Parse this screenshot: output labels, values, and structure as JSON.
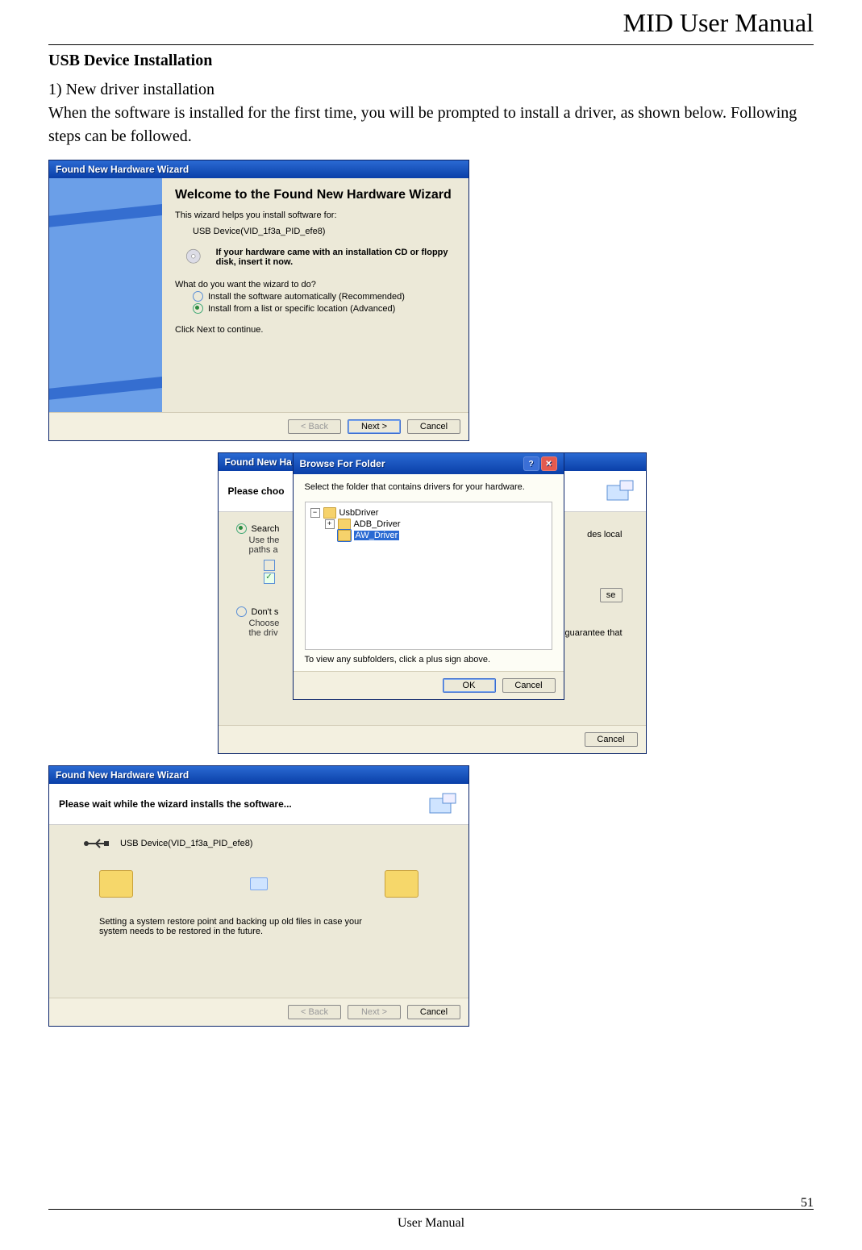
{
  "page": {
    "header_title": "MID User Manual",
    "section_heading": "USB Device Installation",
    "subhead": "1) New driver installation",
    "intro": "When the software is installed for the first time, you will be prompted to install a driver, as shown below. Following steps can be followed.",
    "footer_label": "User Manual",
    "page_number": "51"
  },
  "wizard1": {
    "title": "Found New Hardware Wizard",
    "heading": "Welcome to the Found New Hardware Wizard",
    "line1": "This wizard helps you install software for:",
    "device": "USB Device(VID_1f3a_PID_efe8)",
    "hint": "If your hardware came with an installation CD or floppy disk, insert it now.",
    "question": "What do you want the wizard to do?",
    "opt1": "Install the software automatically (Recommended)",
    "opt2": "Install from a list or specific location (Advanced)",
    "continue": "Click Next to continue.",
    "btn_back": "< Back",
    "btn_next": "Next >",
    "btn_cancel": "Cancel"
  },
  "wizard2_back": {
    "title": "Found New Ha",
    "head": "Please choo",
    "opt_search": "Search",
    "search_sub": "Use the\npaths a",
    "opt_dont": "Don't s",
    "dont_sub": "Choose\nthe driv",
    "frag_right1": "des local",
    "frag_right_btn": "se",
    "frag_right2": "guarantee that",
    "btn_cancel": "Cancel"
  },
  "browse": {
    "title": "Browse For Folder",
    "prompt": "Select the folder that contains drivers for your hardware.",
    "tree_root": "UsbDriver",
    "tree_child1": "ADB_Driver",
    "tree_child2": "AW_Driver",
    "footer_hint": "To view any subfolders, click a plus sign above.",
    "btn_ok": "OK",
    "btn_cancel": "Cancel"
  },
  "wizard3": {
    "title": "Found New Hardware Wizard",
    "head": "Please wait while the wizard installs the software...",
    "device": "USB Device(VID_1f3a_PID_efe8)",
    "status": "Setting a system restore point and backing up old files in case your system needs to be restored in the future.",
    "btn_back": "< Back",
    "btn_next": "Next >",
    "btn_cancel": "Cancel"
  }
}
